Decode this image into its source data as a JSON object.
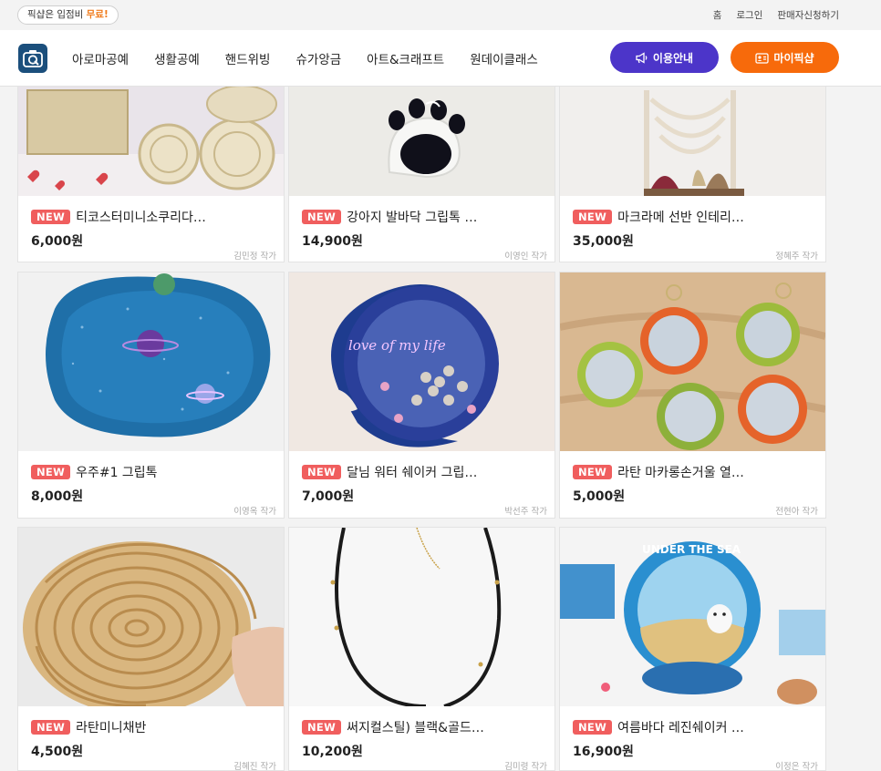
{
  "topbar": {
    "promo_text": "픽샵은 입점비 ",
    "promo_free": "무료!",
    "links": [
      "홈",
      "로그인",
      "판매자신청하기"
    ]
  },
  "header": {
    "logo_icon": "camera-logo-icon",
    "nav": [
      "아로마공예",
      "생활공예",
      "핸드위빙",
      "슈가앙금",
      "아트&크래프트",
      "원데이클래스"
    ],
    "guide_button": "이용안내",
    "my_button": "마이픽샵",
    "colors": {
      "guide": "#4c35c9",
      "my": "#f76a0b",
      "badge": "#f05e5e"
    }
  },
  "products": [
    {
      "badge": "NEW",
      "title": "티코스터미니소쿠리다…",
      "price": "6,000원",
      "artist": "김민정 작가"
    },
    {
      "badge": "NEW",
      "title": "강아지 발바닥 그립톡 …",
      "price": "14,900원",
      "artist": "이영인 작가"
    },
    {
      "badge": "NEW",
      "title": "마크라메 선반 인테리…",
      "price": "35,000원",
      "artist": "정혜주 작가"
    },
    {
      "badge": "NEW",
      "title": "우주#1 그립톡",
      "price": "8,000원",
      "artist": "이영옥 작가"
    },
    {
      "badge": "NEW",
      "title": "달님 워터 쉐이커 그립…",
      "price": "7,000원",
      "artist": "박선주 작가"
    },
    {
      "badge": "NEW",
      "title": "라탄 마카롱손거울 열…",
      "price": "5,000원",
      "artist": "전현아 작가"
    },
    {
      "badge": "NEW",
      "title": "라탄미니채반",
      "price": "4,500원",
      "artist": "김혜진 작가"
    },
    {
      "badge": "NEW",
      "title": "써지컬스틸) 블랙&골드…",
      "price": "10,200원",
      "artist": "김미령 작가"
    },
    {
      "badge": "NEW",
      "title": "여름바다 레진쉐이커 …",
      "price": "16,900원",
      "artist": "이정은 작가"
    }
  ]
}
